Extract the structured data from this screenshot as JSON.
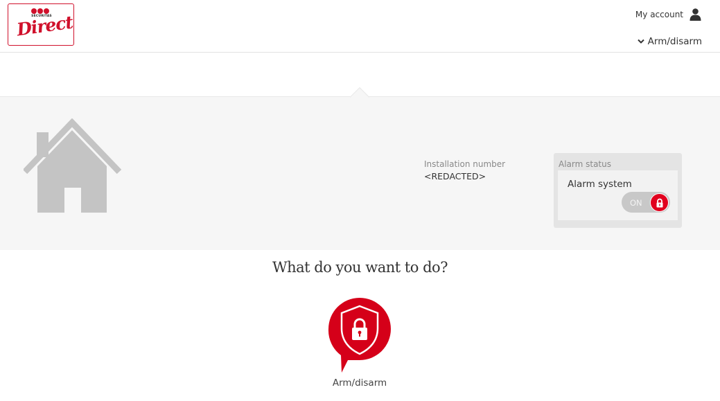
{
  "header": {
    "logo": {
      "small_text": "SECURITAS",
      "brand": "Direct"
    },
    "account_label": "My account",
    "nav_label": "Arm/disarm"
  },
  "installation": {
    "caption": "Installation number",
    "value": "<REDACTED>"
  },
  "alarm": {
    "caption": "Alarm status",
    "system_label": "Alarm system",
    "toggle_text": "ON"
  },
  "actions": {
    "question": "What do you want to do?",
    "items": [
      {
        "label": "Arm/disarm",
        "icon": "shield-lock-icon"
      }
    ]
  },
  "colors": {
    "brand_red": "#d0102b",
    "toggle_red": "#e1001e",
    "band_gray": "#f6f6f6"
  }
}
